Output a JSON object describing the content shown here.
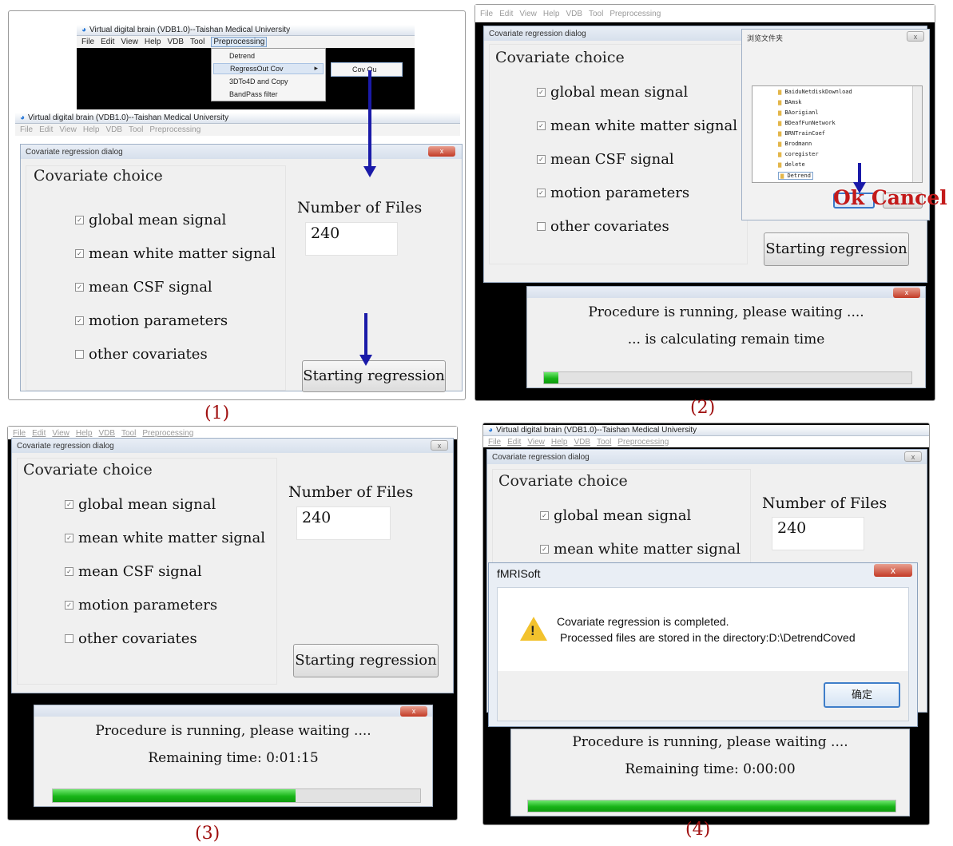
{
  "app": {
    "window_title": "Virtual digital brain (VDB1.0)--Taishan Medical University",
    "menu": [
      "File",
      "Edit",
      "View",
      "Help",
      "VDB",
      "Tool",
      "Preprocessing"
    ]
  },
  "preprocessing_menu": {
    "items": [
      "Detrend",
      "RegressOut Cov",
      "3DTo4D and Copy",
      "BandPass filter"
    ],
    "submenu_item": "Cov Ou"
  },
  "dialog": {
    "title": "Covariate regression dialog",
    "close_glyph": "x",
    "group_title": "Covariate choice",
    "options": [
      {
        "label": "global mean signal",
        "checked": true
      },
      {
        "label": "mean white matter signal",
        "checked": true
      },
      {
        "label": "mean CSF signal",
        "checked": true
      },
      {
        "label": "motion parameters",
        "checked": true
      },
      {
        "label": "other covariates",
        "checked": false
      }
    ],
    "number_of_files_label": "Number of Files",
    "number_of_files_value": "240",
    "start_button": "Starting regression"
  },
  "folder_browser": {
    "title": "浏览文件夹",
    "items": [
      "BaiduNetdiskDownload",
      "BAmsk",
      "BAorigianl",
      "BDeafFunNetwork",
      "BRNTrainCoef",
      "Brodmann",
      "coregister",
      "delete",
      "Detrend"
    ],
    "ok_button": "Ok",
    "cancel_button": "Cancel"
  },
  "progress": {
    "running_text": "Procedure is running, please waiting ....",
    "calculating_text": "... is calculating remain time",
    "remaining_3": "Remaining time: 0:01:15",
    "remaining_4": "Remaining time: 0:00:00",
    "fraction_2": 0.04,
    "fraction_3": 0.66,
    "fraction_4": 1.0
  },
  "message_box": {
    "title": "fMRISoft",
    "line1": "Covariate regression is completed.",
    "line2": "Processed files are stored in the directory:D:\\DetrendCoved",
    "ok_button": "确定"
  },
  "captions": [
    "(1)",
    "(2)",
    "(3)",
    "(4)"
  ],
  "colors": {
    "progress": "#18b418",
    "arrow": "#1a1aa8",
    "caption": "#a01010",
    "close_button": "#c33a26"
  }
}
